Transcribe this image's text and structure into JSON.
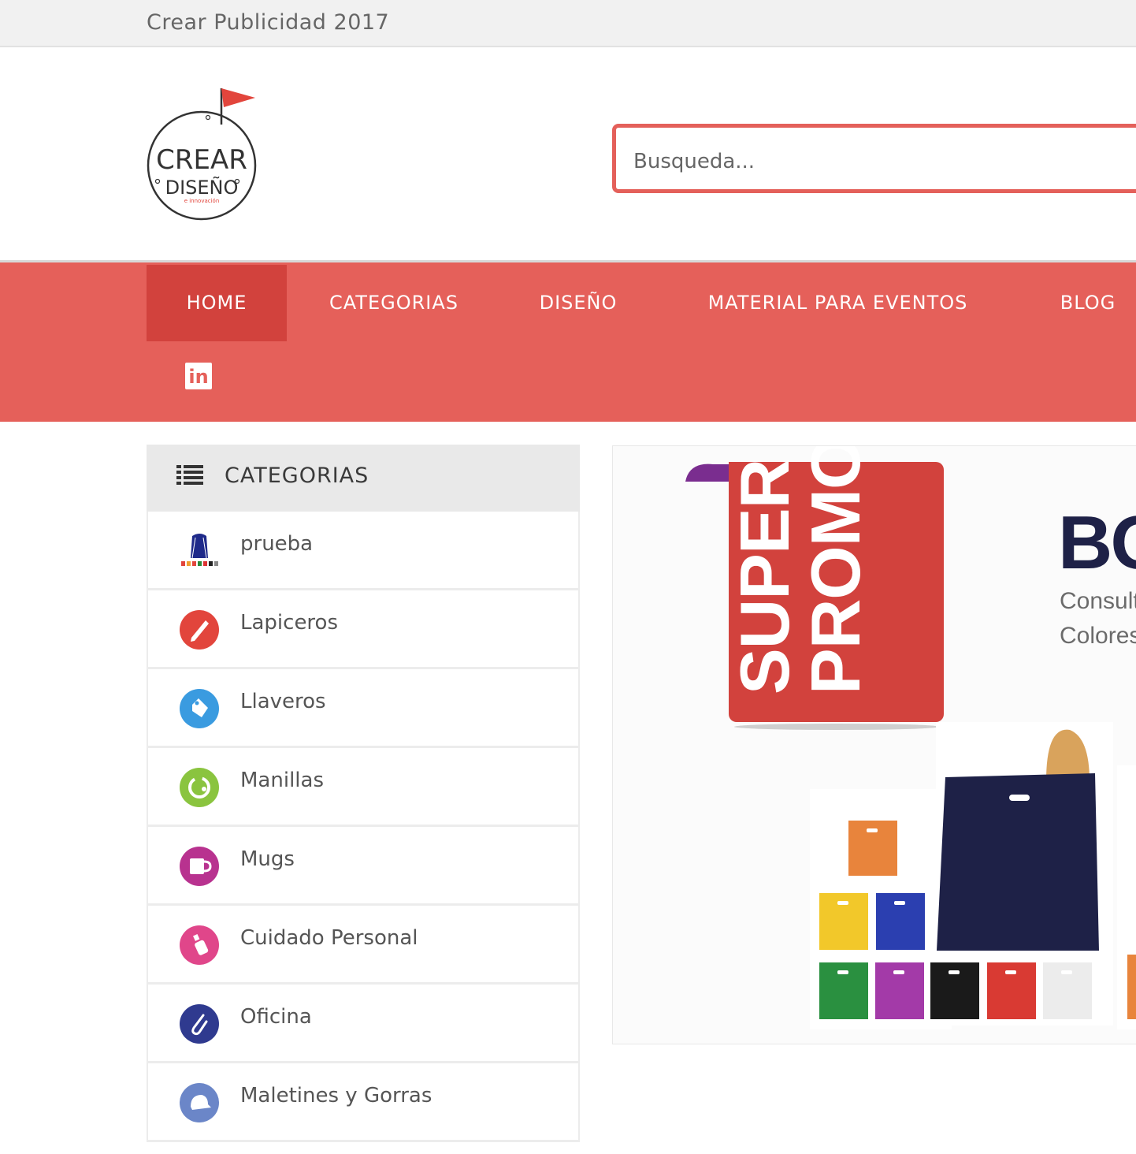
{
  "topbar": {
    "title": "Crear Publicidad 2017"
  },
  "logo": {
    "line1": "CREAR",
    "line2": "DISEÑO",
    "line3": "e innovación"
  },
  "search": {
    "placeholder": "Busqueda..."
  },
  "nav": {
    "items": [
      {
        "label": "HOME",
        "active": true
      },
      {
        "label": "CATEGORIAS",
        "active": false
      },
      {
        "label": "DISEÑO",
        "active": false
      },
      {
        "label": "MATERIAL PARA EVENTOS",
        "active": false
      },
      {
        "label": "BLOG",
        "active": false
      }
    ],
    "social": {
      "label": "in",
      "icon": "linkedin-icon"
    }
  },
  "sidebar": {
    "header": "CATEGORIAS",
    "items": [
      {
        "label": "prueba",
        "icon": "backpack-icon",
        "color": "#1f2a8a"
      },
      {
        "label": "Lapiceros",
        "icon": "pen-icon",
        "color": "#e2453c"
      },
      {
        "label": "Llaveros",
        "icon": "tag-icon",
        "color": "#3a9be0"
      },
      {
        "label": "Manillas",
        "icon": "bracelet-icon",
        "color": "#8ac43f"
      },
      {
        "label": "Mugs",
        "icon": "mug-icon",
        "color": "#b8328f"
      },
      {
        "label": "Cuidado Personal",
        "icon": "lotion-bottle-icon",
        "color": "#e0468a"
      },
      {
        "label": "Oficina",
        "icon": "paperclip-icon",
        "color": "#2f3a8f"
      },
      {
        "label": "Maletines y Gorras",
        "icon": "cap-icon",
        "color": "#6b86c8"
      }
    ]
  },
  "banner": {
    "promo_line1": "SUPER",
    "promo_line2": "PROMO",
    "title": "BO",
    "line1": "Consult",
    "line2": "Colores"
  },
  "colors": {
    "accent": "#e5605a",
    "accent_dark": "#d2423d",
    "promo_red": "#d2423d",
    "navy": "#1e2147"
  }
}
